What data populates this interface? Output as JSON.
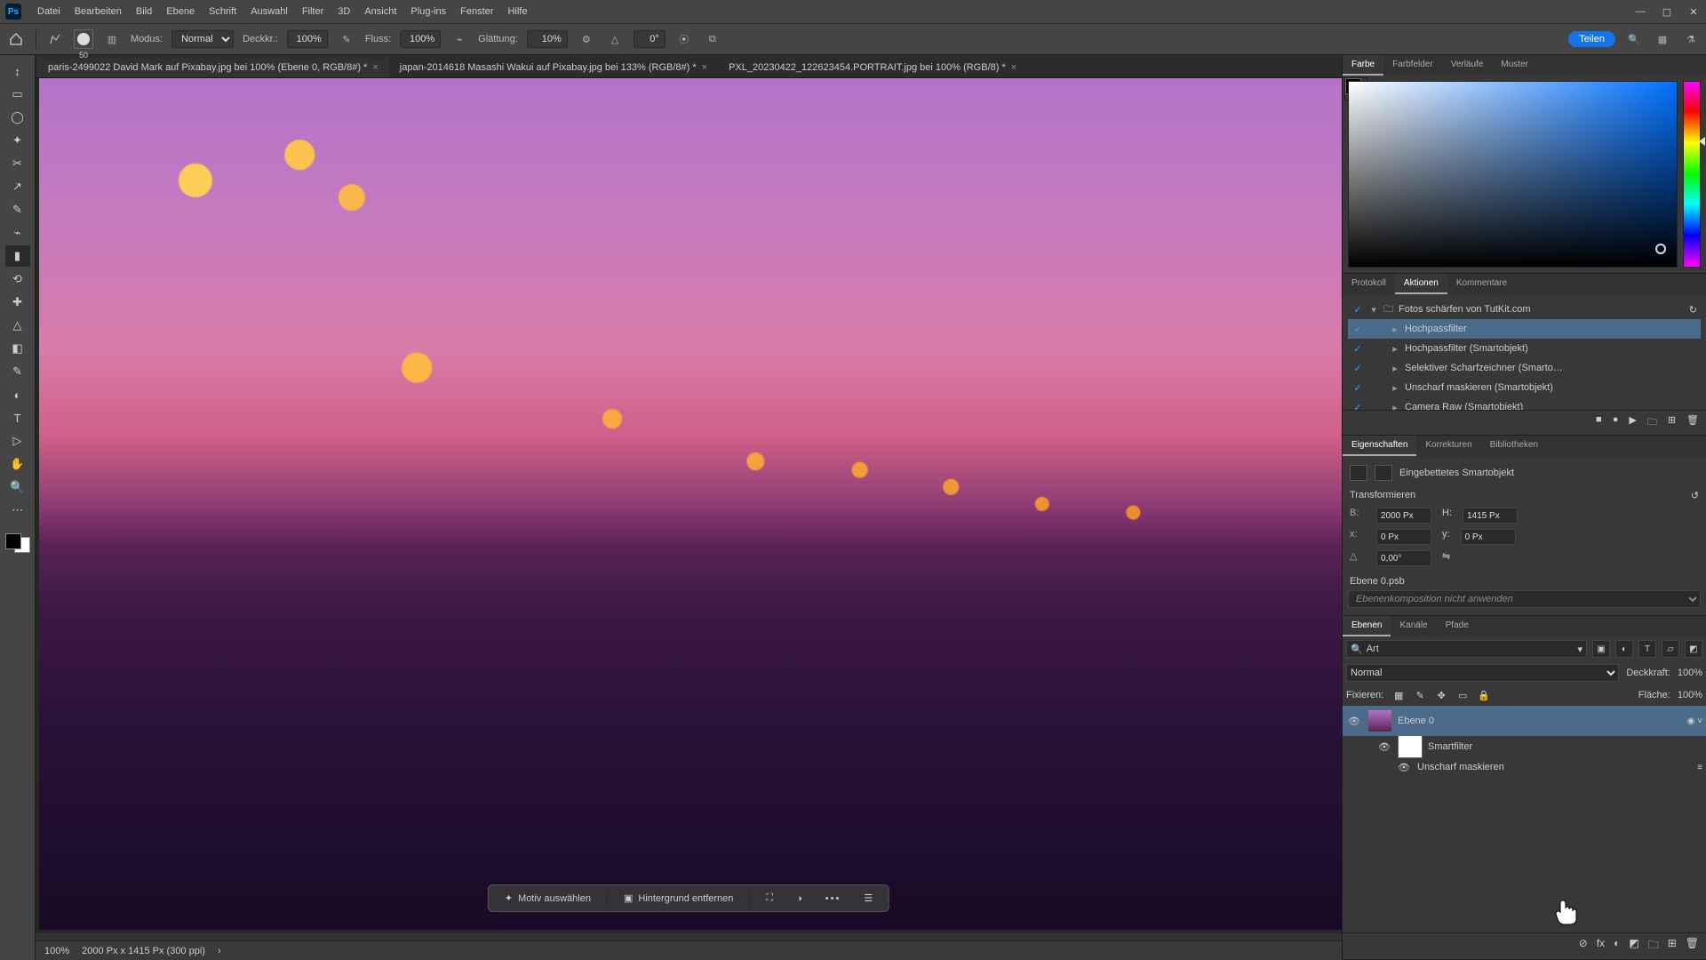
{
  "app": {
    "logo": "Ps"
  },
  "menu": {
    "items": [
      "Datei",
      "Bearbeiten",
      "Bild",
      "Ebene",
      "Schrift",
      "Auswahl",
      "Filter",
      "3D",
      "Ansicht",
      "Plug-ins",
      "Fenster",
      "Hilfe"
    ]
  },
  "win": {
    "min": "—",
    "max": "▢",
    "close": "✕"
  },
  "options": {
    "brush_size": "50",
    "mode_label": "Modus:",
    "mode_value": "Normal",
    "opacity_label": "Deckkr.:",
    "opacity_value": "100%",
    "flow_label": "Fluss:",
    "flow_value": "100%",
    "smooth_label": "Glättung:",
    "smooth_value": "10%",
    "angle_value": "0°",
    "share": "Teilen"
  },
  "tabs": [
    {
      "label": "paris-2499022  David Mark auf Pixabay.jpg bei 100% (Ebene 0, RGB/8#) *",
      "active": true
    },
    {
      "label": "japan-2014618 Masashi Wakui auf Pixabay.jpg bei 133% (RGB/8#) *",
      "active": false
    },
    {
      "label": "PXL_20230422_122623454.PORTRAIT.jpg bei 100% (RGB/8) *",
      "active": false
    }
  ],
  "status": {
    "zoom": "100%",
    "doc": "2000 Px x 1415 Px (300 ppi)"
  },
  "tools": [
    "↕",
    "▭",
    "◯",
    "✦",
    "✂",
    "↗",
    "✎",
    "⌁",
    "▮",
    "⟲",
    "✚",
    "△",
    "◧",
    "✎",
    "◐",
    "T",
    "▷",
    "✋",
    "🔍",
    "⋯"
  ],
  "context_bar": {
    "select_subject": "Motiv auswählen",
    "remove_bg": "Hintergrund entfernen",
    "more": "•••"
  },
  "panel_color": {
    "tabs": [
      "Farbe",
      "Farbfelder",
      "Verläufe",
      "Muster"
    ]
  },
  "panel_actions": {
    "tabs": [
      "Protokoll",
      "Aktionen",
      "Kommentare"
    ],
    "rows": [
      {
        "check": true,
        "indent": 0,
        "folder": true,
        "label": "Fotos schärfen von TutKit.com",
        "sel": false
      },
      {
        "check": true,
        "indent": 1,
        "label": "Hochpassfilter",
        "sel": true
      },
      {
        "check": true,
        "indent": 1,
        "label": "Hochpassfilter (Smartobjekt)",
        "sel": false
      },
      {
        "check": true,
        "indent": 1,
        "label": "Selektiver Scharfzeichner (Smarto…",
        "sel": false
      },
      {
        "check": true,
        "indent": 1,
        "label": "Unscharf maskieren (Smartobjekt)",
        "sel": false
      },
      {
        "check": true,
        "indent": 1,
        "label": "Camera Raw (Smartobjekt)",
        "sel": false
      }
    ],
    "ctrl": {
      "stop": "■",
      "rec": "●",
      "play": "▶",
      "new": "⊞",
      "del": "🗑",
      "reset": "↻"
    }
  },
  "panel_props": {
    "tabs": [
      "Eigenschaften",
      "Korrekturen",
      "Bibliotheken"
    ],
    "type_label": "Eingebettetes Smartobjekt",
    "transform_title": "Transformieren",
    "reset": "↺",
    "w_label": "B:",
    "w_value": "2000 Px",
    "h_label": "H:",
    "h_value": "1415 Px",
    "x_label": "x:",
    "x_value": "0 Px",
    "y_label": "y:",
    "y_value": "0 Px",
    "angle": "0,00°",
    "source_title": "Ebene 0.psb",
    "comp_placeholder": "Ebenenkomposition nicht anwenden"
  },
  "panel_layers": {
    "tabs": [
      "Ebenen",
      "Kanäle",
      "Pfade"
    ],
    "search_kind": "Art",
    "blend_label": "Normal",
    "opacity_label": "Deckkraft:",
    "opacity_value": "100%",
    "lock_label": "Fixieren:",
    "fill_label": "Fläche:",
    "fill_value": "100%",
    "layer_name": "Ebene 0",
    "smart_filters": "Smartfilter",
    "filter1": "Unscharf maskieren",
    "bottom_icons": [
      "⊘",
      "fx",
      "◐",
      "◩",
      "🗀",
      "⊞",
      "🗑"
    ]
  }
}
